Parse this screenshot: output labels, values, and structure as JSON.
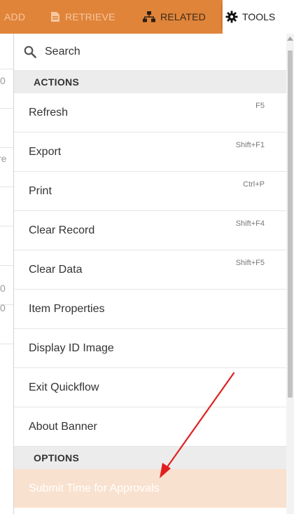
{
  "toolbar": {
    "add_label": "ADD",
    "retrieve_label": "RETRIEVE",
    "related_label": "RELATED",
    "tools_label": "TOOLS"
  },
  "icons": {
    "retrieve": "document-download-icon",
    "related": "hierarchy-icon",
    "tools": "gear-icon",
    "search": "search-icon"
  },
  "colors": {
    "toolbar_bg": "#e0843a",
    "highlight_bg": "#f9e1cf",
    "annotation_arrow": "#e02020"
  },
  "background_page": {
    "chars": [
      "0",
      "re",
      "0",
      "0"
    ]
  },
  "menu": {
    "search_label": "Search",
    "actions_header": "ACTIONS",
    "items": [
      {
        "label": "Refresh",
        "shortcut": "F5"
      },
      {
        "label": "Export",
        "shortcut": "Shift+F1"
      },
      {
        "label": "Print",
        "shortcut": "Ctrl+P"
      },
      {
        "label": "Clear Record",
        "shortcut": "Shift+F4"
      },
      {
        "label": "Clear Data",
        "shortcut": "Shift+F5"
      },
      {
        "label": "Item Properties",
        "shortcut": ""
      },
      {
        "label": "Display ID Image",
        "shortcut": ""
      },
      {
        "label": "Exit Quickflow",
        "shortcut": ""
      },
      {
        "label": "About Banner",
        "shortcut": ""
      }
    ],
    "options_header": "OPTIONS",
    "options_items": [
      {
        "label": "Submit Time for Approvals"
      }
    ]
  }
}
